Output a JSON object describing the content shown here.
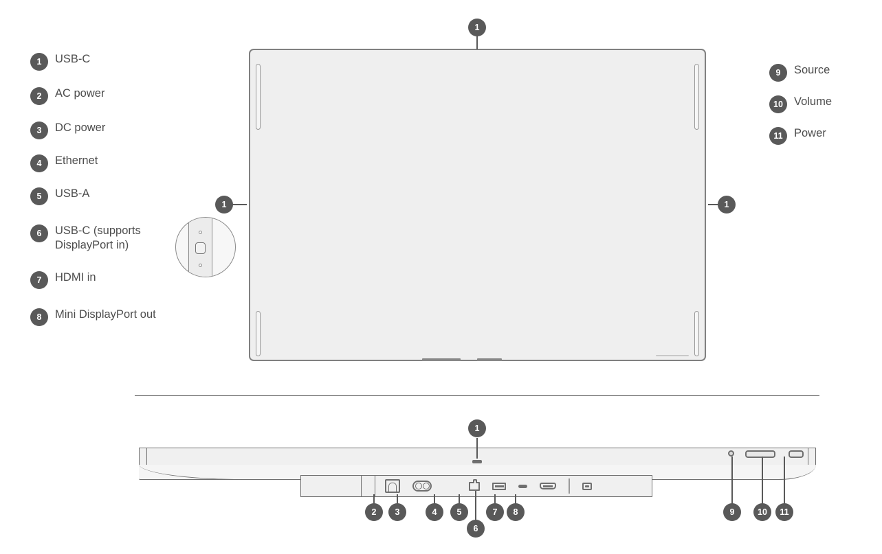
{
  "diagram": {
    "title": "Display ports and controls diagram",
    "badge_color": "#595959",
    "badge_text_color": "#ffffff",
    "line_color": "#6f6f6f",
    "body_fill": "#efefef"
  },
  "legend_left": [
    {
      "number": "1",
      "label": "USB-C"
    },
    {
      "number": "2",
      "label": "AC power"
    },
    {
      "number": "3",
      "label": "DC power"
    },
    {
      "number": "4",
      "label": "Ethernet"
    },
    {
      "number": "5",
      "label": "USB-A"
    },
    {
      "number": "6",
      "label": "USB-C (supports\nDisplayPort in)"
    },
    {
      "number": "7",
      "label": "HDMI in"
    },
    {
      "number": "8",
      "label": "Mini DisplayPort out"
    }
  ],
  "legend_right": [
    {
      "number": "9",
      "label": "Source"
    },
    {
      "number": "10",
      "label": "Volume"
    },
    {
      "number": "11",
      "label": "Power"
    }
  ],
  "callouts": {
    "rear_top": "1",
    "rear_left": "1",
    "rear_right": "1",
    "edge_top": "1",
    "port_ac": "2",
    "port_dc": "3",
    "port_ethernet": "4",
    "port_usba": "5",
    "port_usbc": "6",
    "port_hdmi": "7",
    "port_mdp": "8",
    "ctrl_source": "9",
    "ctrl_volume": "10",
    "ctrl_power": "11"
  }
}
